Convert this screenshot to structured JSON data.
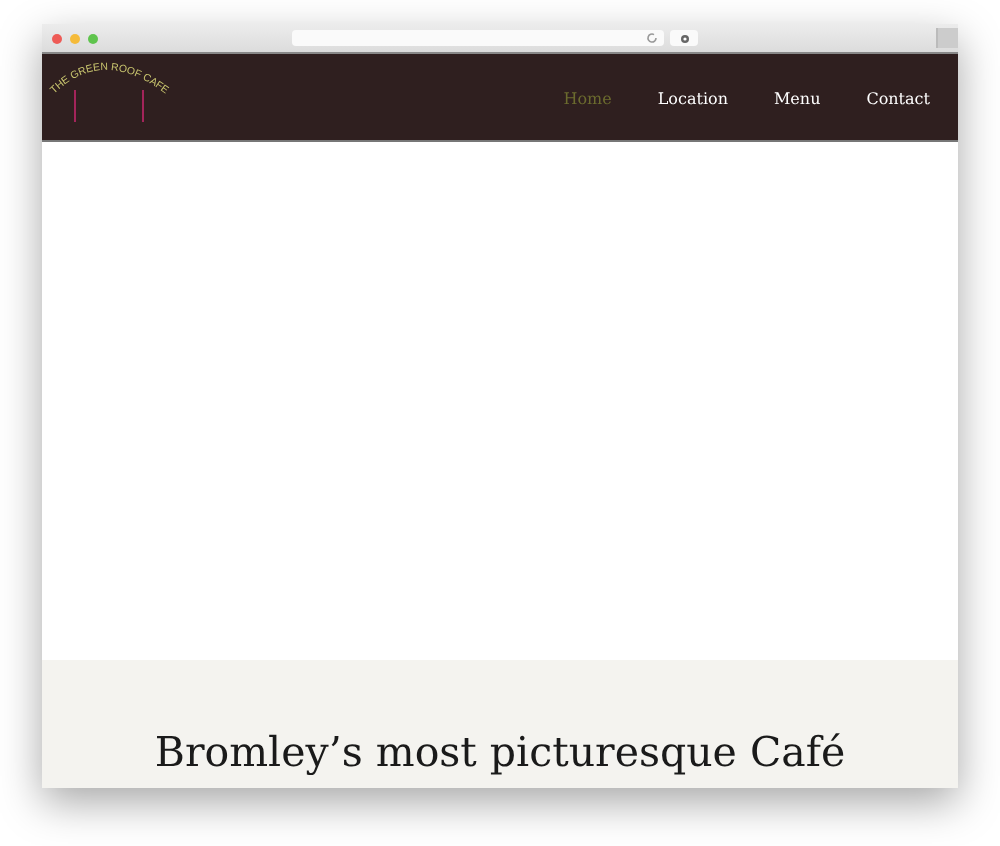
{
  "logo": {
    "text": "THE GREEN ROOF CAFE"
  },
  "nav": [
    {
      "label": "Home",
      "selected": true
    },
    {
      "label": "Location",
      "selected": false
    },
    {
      "label": "Menu",
      "selected": false
    },
    {
      "label": "Contact",
      "selected": false
    }
  ],
  "hero": {
    "heading": "Bromley’s most picturesque Café"
  }
}
